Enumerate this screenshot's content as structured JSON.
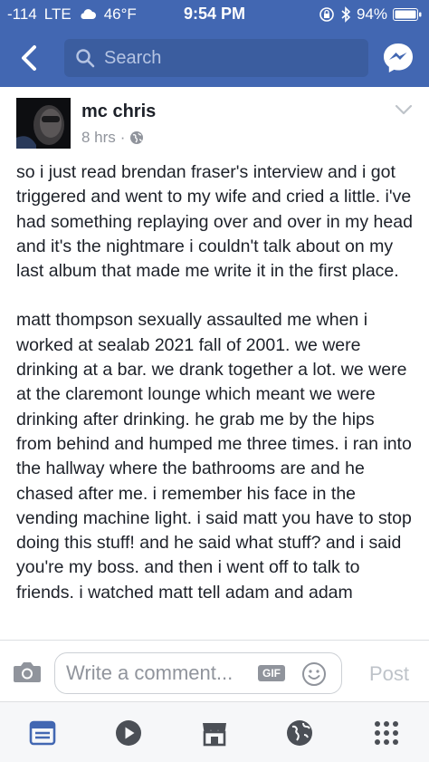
{
  "status_bar": {
    "signal": "-114",
    "network": "LTE",
    "weather_icon": "cloud-icon",
    "temperature": "46°F",
    "time": "9:54 PM",
    "battery": "94%"
  },
  "nav": {
    "search_placeholder": "Search",
    "back_icon": "back-chevron-icon",
    "messenger_icon": "messenger-icon"
  },
  "post": {
    "author": "mc chris",
    "timestamp": "8 hrs",
    "separator": "·",
    "privacy_icon": "globe-icon",
    "paragraphs": [
      "so i just read brendan fraser's interview and i got triggered and went to my wife and cried a little. i've had something replaying over and over in my head and it's the nightmare i couldn't talk about on my last album that made me write it in the first place.",
      "matt thompson sexually assaulted me when i worked at sealab 2021 fall of 2001. we were drinking at a bar. we drank together a lot. we were at the claremont lounge which meant we were drinking after drinking. he grab me by the hips from behind and humped me three times. i ran into the hallway where the bathrooms are and he chased after me. i remember his face in the vending machine light. i said matt you have to stop doing this stuff! and he said what stuff? and i said you're my boss. and then i went off to talk to friends. i watched matt tell adam and adam"
    ]
  },
  "comment_bar": {
    "placeholder": "Write a comment...",
    "gif_label": "GIF",
    "post_label": "Post"
  },
  "tabbar": {
    "tabs": [
      "news-feed-icon",
      "video-icon",
      "marketplace-icon",
      "notifications-globe-icon",
      "more-menu-icon"
    ],
    "active_color": "#4267b2",
    "inactive_color": "#4b4f56"
  },
  "colors": {
    "brand": "#4267b2",
    "search_bg": "#3b5d9f",
    "meta_text": "#90949c"
  }
}
